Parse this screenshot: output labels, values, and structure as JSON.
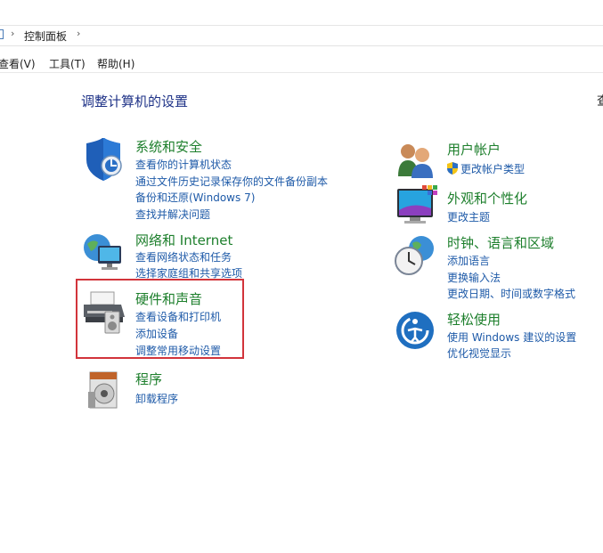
{
  "address": {
    "breadcrumb": "控制面板"
  },
  "menu": {
    "view": "查看(V)",
    "tools": "工具(T)",
    "help": "帮助(H)"
  },
  "page": {
    "title": "调整计算机的设置",
    "view_by_cut": "查"
  },
  "categories": {
    "system": {
      "title": "系统和安全",
      "links": [
        "查看你的计算机状态",
        "通过文件历史记录保存你的文件备份副本",
        "备份和还原(Windows 7)",
        "查找并解决问题"
      ]
    },
    "network": {
      "title": "网络和 Internet",
      "links": [
        "查看网络状态和任务",
        "选择家庭组和共享选项"
      ]
    },
    "hardware": {
      "title": "硬件和声音",
      "links": [
        "查看设备和打印机",
        "添加设备",
        "调整常用移动设置"
      ]
    },
    "programs": {
      "title": "程序",
      "links": [
        "卸载程序"
      ]
    },
    "users": {
      "title": "用户帐户",
      "links": [
        "更改帐户类型"
      ]
    },
    "appearance": {
      "title": "外观和个性化",
      "links": [
        "更改主题"
      ]
    },
    "clock": {
      "title": "时钟、语言和区域",
      "links": [
        "添加语言",
        "更换输入法",
        "更改日期、时间或数字格式"
      ]
    },
    "ease": {
      "title": "轻松使用",
      "links": [
        "使用 Windows 建议的设置",
        "优化视觉显示"
      ]
    }
  },
  "colors": {
    "category_title": "#1d7f2c",
    "link": "#1e5aa8",
    "highlight_box": "#d2343b",
    "page_title": "#1e3287"
  }
}
